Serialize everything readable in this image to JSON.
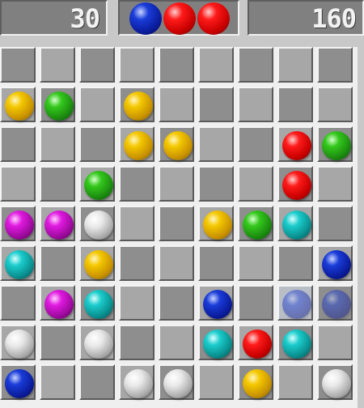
{
  "score": {
    "left": "30",
    "right": "160"
  },
  "next_balls": [
    "blue",
    "red",
    "red"
  ],
  "colors": {
    "yellow": "#f4c800",
    "green": "#34c81c",
    "red": "#ff1a1a",
    "blue": "#1a3cd8",
    "cyan": "#1ccccc",
    "magenta": "#e01ae0",
    "white": "#e8e8e8"
  },
  "board": {
    "rows": 9,
    "cols": 9,
    "selected": [
      6,
      7
    ],
    "ghosts": [
      [
        6,
        7
      ],
      [
        6,
        8
      ]
    ],
    "cells": [
      [
        null,
        null,
        null,
        null,
        null,
        null,
        null,
        null,
        null
      ],
      [
        "yellow",
        "green",
        null,
        "yellow",
        null,
        null,
        null,
        null,
        null
      ],
      [
        null,
        null,
        null,
        "yellow",
        "yellow",
        null,
        null,
        "red",
        "green"
      ],
      [
        null,
        null,
        "green",
        null,
        null,
        null,
        null,
        "red",
        null
      ],
      [
        "magenta",
        "magenta",
        "white",
        null,
        null,
        "yellow",
        "green",
        "cyan",
        null
      ],
      [
        "cyan",
        null,
        "yellow",
        null,
        null,
        null,
        null,
        null,
        "blue"
      ],
      [
        null,
        "magenta",
        "cyan",
        null,
        null,
        "blue",
        null,
        "blue",
        "blue"
      ],
      [
        "white",
        null,
        "white",
        null,
        null,
        "cyan",
        "red",
        "cyan",
        null
      ],
      [
        "blue",
        null,
        null,
        "white",
        "white",
        null,
        "yellow",
        null,
        "white"
      ]
    ]
  }
}
